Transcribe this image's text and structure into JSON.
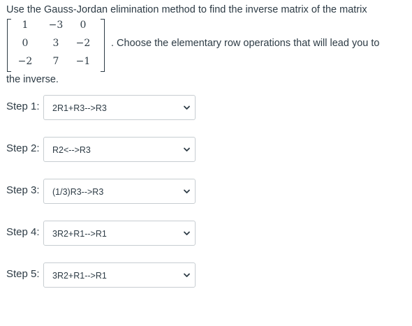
{
  "question": {
    "intro": "Use the Gauss-Jordan elimination method to find the inverse matrix of the matrix",
    "matrix": [
      [
        "1",
        "−3",
        "0"
      ],
      [
        "0",
        "3",
        "−2"
      ],
      [
        "−2",
        "7",
        "−1"
      ]
    ],
    "suffix": ". Choose the elementary row operations that will lead you to",
    "ending": "the inverse."
  },
  "steps": [
    {
      "label": "Step 1:",
      "selected": "2R1+R3-->R3"
    },
    {
      "label": "Step 2:",
      "selected": "R2<-->R3"
    },
    {
      "label": "Step 3:",
      "selected": "(1/3)R3-->R3"
    },
    {
      "label": "Step 4:",
      "selected": "3R2+R1-->R1"
    },
    {
      "label": "Step 5:",
      "selected": "3R2+R1-->R1"
    }
  ],
  "icons": {
    "dropdown": "chevron-down-icon"
  },
  "colors": {
    "text": "#2d3b45",
    "border": "#c7cdd1",
    "background": "#ffffff"
  }
}
